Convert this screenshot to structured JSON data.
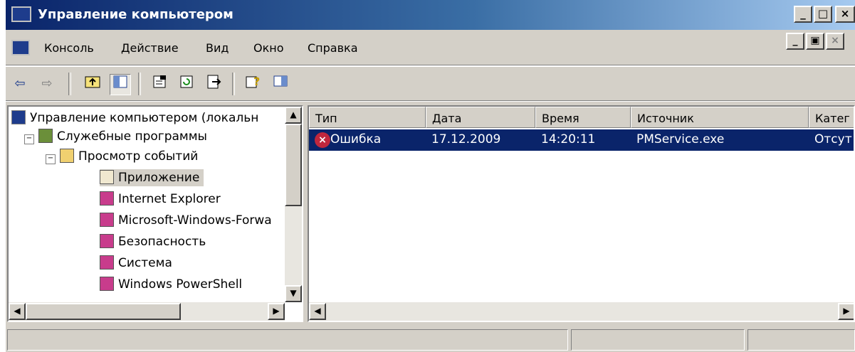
{
  "window": {
    "title": "Управление компьютером"
  },
  "menu": {
    "console": "Консоль",
    "action": "Действие",
    "view": "Вид",
    "window": "Окно",
    "help": "Справка"
  },
  "tree": {
    "root": "Управление компьютером (локальн",
    "system_tools": "Служебные программы",
    "event_viewer": "Просмотр событий",
    "logs": [
      "Приложение",
      "Internet Explorer",
      "Microsoft-Windows-Forwa",
      "Безопасность",
      "Система",
      "Windows PowerShell"
    ]
  },
  "table": {
    "columns": [
      "Тип",
      "Дата",
      "Время",
      "Источник",
      "Катег"
    ],
    "rows": [
      {
        "type": "Ошибка",
        "date": "17.12.2009",
        "time": "14:20:11",
        "source": "PMService.exe",
        "category": "Отсут"
      }
    ]
  },
  "colors": {
    "title_start": "#0a246a",
    "title_end": "#a6caf0",
    "selection": "#0a246a",
    "error": "#c0273d",
    "chrome": "#d4d0c8"
  }
}
